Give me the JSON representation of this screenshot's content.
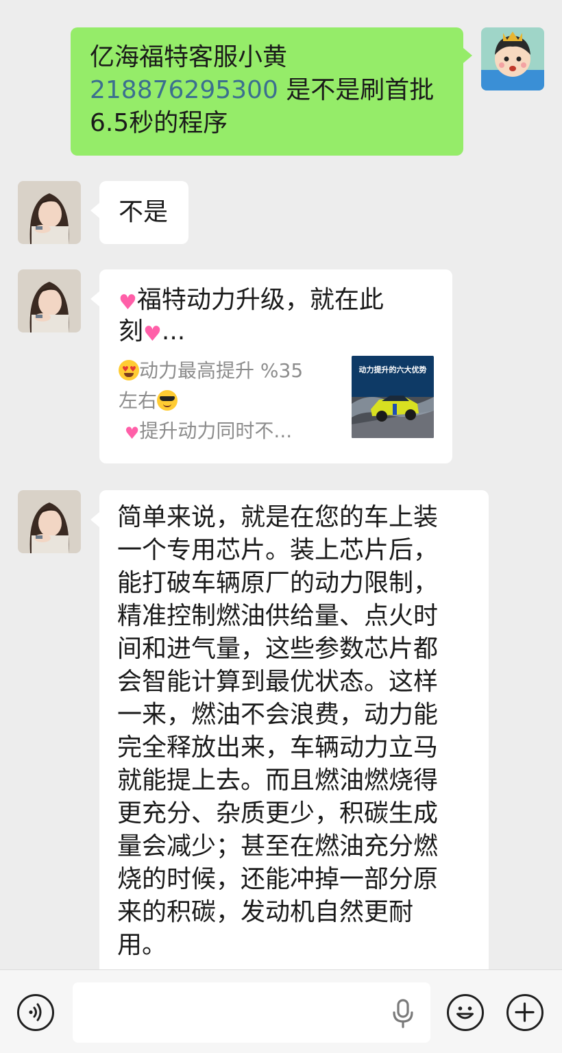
{
  "conversation": {
    "messages": [
      {
        "sender": "me",
        "text_line1": "亿海福特客服小黄",
        "phone": "218876295300",
        "text_after_phone": " 是不是刷首批",
        "text_line3": "6.5秒的程序"
      },
      {
        "sender": "contact",
        "text": "不是"
      },
      {
        "sender": "contact",
        "type": "link_card",
        "title_part1": "福特动力升级，就在此",
        "title_part2": "刻",
        "title_ellipsis": "...",
        "desc_line1": "动力最高提升 %35",
        "desc_line2": "左右",
        "desc_line3": "提升动力同时不...",
        "thumbnail_caption": "动力提升的六大优势",
        "icons": [
          "sparkling-heart-icon",
          "heart-eyes-emoji-icon",
          "sunglasses-emoji-icon",
          "two-hearts-icon"
        ]
      },
      {
        "sender": "contact",
        "text": "简单来说，就是在您的车上装\n一个专用芯片。装上芯片后，\n能打破车辆原厂的动力限制，\n精准控制燃油供给量、点火时\n间和进气量，这些参数芯片都\n会智能计算到最优状态。这样\n一来，燃油不会浪费，动力能\n完全释放出来，车辆动力立马\n就能提上去。而且燃油燃烧得\n更充分、杂质更少，积碳生成\n量会减少；甚至在燃油充分燃\n烧的时候，还能冲掉一部分原\n来的积碳，发动机自然更耐\n用。"
      }
    ]
  },
  "input_bar": {
    "value": "",
    "icons": [
      "voice-mode-icon",
      "microphone-icon",
      "emoji-icon",
      "add-icon"
    ]
  },
  "colors": {
    "background": "#ededed",
    "outgoing_bubble": "#95ec69",
    "incoming_bubble": "#ffffff",
    "phone_link": "#3b6f8f",
    "secondary_text": "#8c8c8c"
  }
}
